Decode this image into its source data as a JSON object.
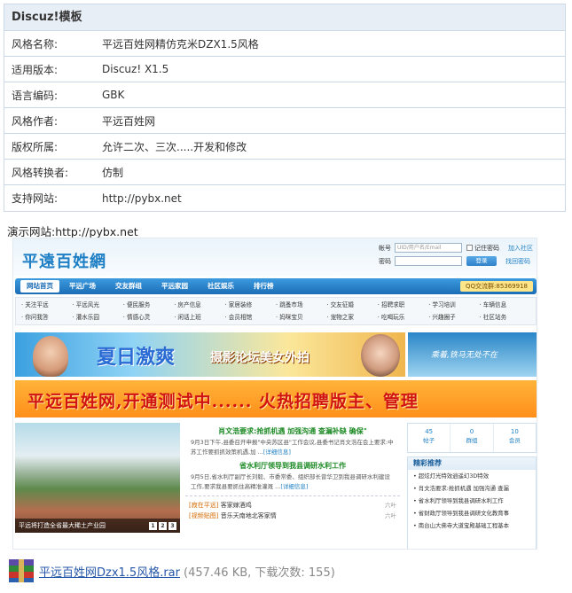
{
  "info": {
    "title": "Discuz!模板",
    "rows": [
      {
        "key": "风格名称:",
        "value": "平远百姓网精仿克米DZX1.5风格"
      },
      {
        "key": "适用版本:",
        "value": "Discuz! X1.5"
      },
      {
        "key": "语言编码:",
        "value": "GBK"
      },
      {
        "key": "风格作者:",
        "value": "平远百姓网"
      },
      {
        "key": "版权所属:",
        "value": "允许二次、三次.....开发和修改"
      },
      {
        "key": "风格转换者:",
        "value": "仿制"
      },
      {
        "key": "支持网站:",
        "value": "http://pybx.net"
      }
    ]
  },
  "demo_label": "演示网站:http://pybx.net",
  "preview": {
    "logo": "平遠百姓網",
    "login": {
      "account_label": "帐号",
      "account_placeholder": "UID/用户名/Email",
      "remember": "记住密码",
      "register": "加入社区",
      "password_label": "密码",
      "login_button": "登录",
      "forgot": "找回密码"
    },
    "nav": [
      "网站首页",
      "平远广场",
      "交友群组",
      "平远家园",
      "社区娱乐",
      "排行榜"
    ],
    "qq": "QQ交流群:85369918",
    "subnav": [
      "· 关注平远",
      "· 平远风光",
      "· 便民服务",
      "· 房产信息",
      "· 家居装修",
      "· 跳蚤市场",
      "· 交友征婚",
      "· 招聘求职",
      "· 学习培训",
      "· 车辆信息",
      "· 你问我答",
      "· 灌水乐园",
      "· 情感心灵",
      "· 闲话上班",
      "· 会员相馆",
      "· 妈咪宝贝",
      "· 宠物之家",
      "· 吃喝玩乐",
      "· 兴趣圈子",
      "· 社区站务"
    ],
    "banner1_title": "夏日激爽",
    "banner1_sub": "摄影论坛美女外拍",
    "banner1_side": "乘着,铁马无处不在",
    "banner2": "平远百姓网,开通测试中...... 火热招聘版主、管理",
    "photo_caption": "平远将打造全省最大稀土产业园",
    "photo_pages": [
      "1",
      "2",
      "3"
    ],
    "news": {
      "headline1": "肖文浩要求:抢抓机遇 加强沟通 查漏补缺 确保\"",
      "para1": "9月3日下午,县委召开申报\"中央苏区县\"工作会议,县委书记肖文浩在会上要求:中苏工作要抓抓效策机遇,加 ...",
      "more1": "[详细信息]",
      "headline2": "省水利厅领导到我县调研水利工作",
      "para2": "9月5日,省水利厅副厅长刘毅、市委常委、组织部长曾华卫到我县调研水利建设工作,要求我县要抓住高精准灌溉 ...",
      "more2": "[详细信息]",
      "list": [
        {
          "cat": "[寂在平远]",
          "title": "客家嫁酒鸡",
          "tag": "六叶"
        },
        {
          "cat": "[视频贴图]",
          "title": "音乐天南地北客家情",
          "tag": "六叶"
        }
      ]
    },
    "stats": [
      {
        "num": "45",
        "label": "帖子"
      },
      {
        "num": "0",
        "label": "群组"
      },
      {
        "num": "10",
        "label": "会员"
      }
    ],
    "recommend_title": "精彩推荐",
    "recommend": [
      "• 超炫灯光特效逍遥幻3D特效",
      "• 肖文浩要求:抢抓机遇 加强沟通 查漏",
      "• 省水利厅领导到我县调研水利工作",
      "• 省财政厅领导到我县调研文化教育事",
      "• 南台山大佛寺大道宝殿基础工程基本"
    ]
  },
  "attachment": {
    "name": "平远百姓网Dzx1.5风格.rar",
    "meta": "(457.46 KB, 下载次数: 155)"
  }
}
